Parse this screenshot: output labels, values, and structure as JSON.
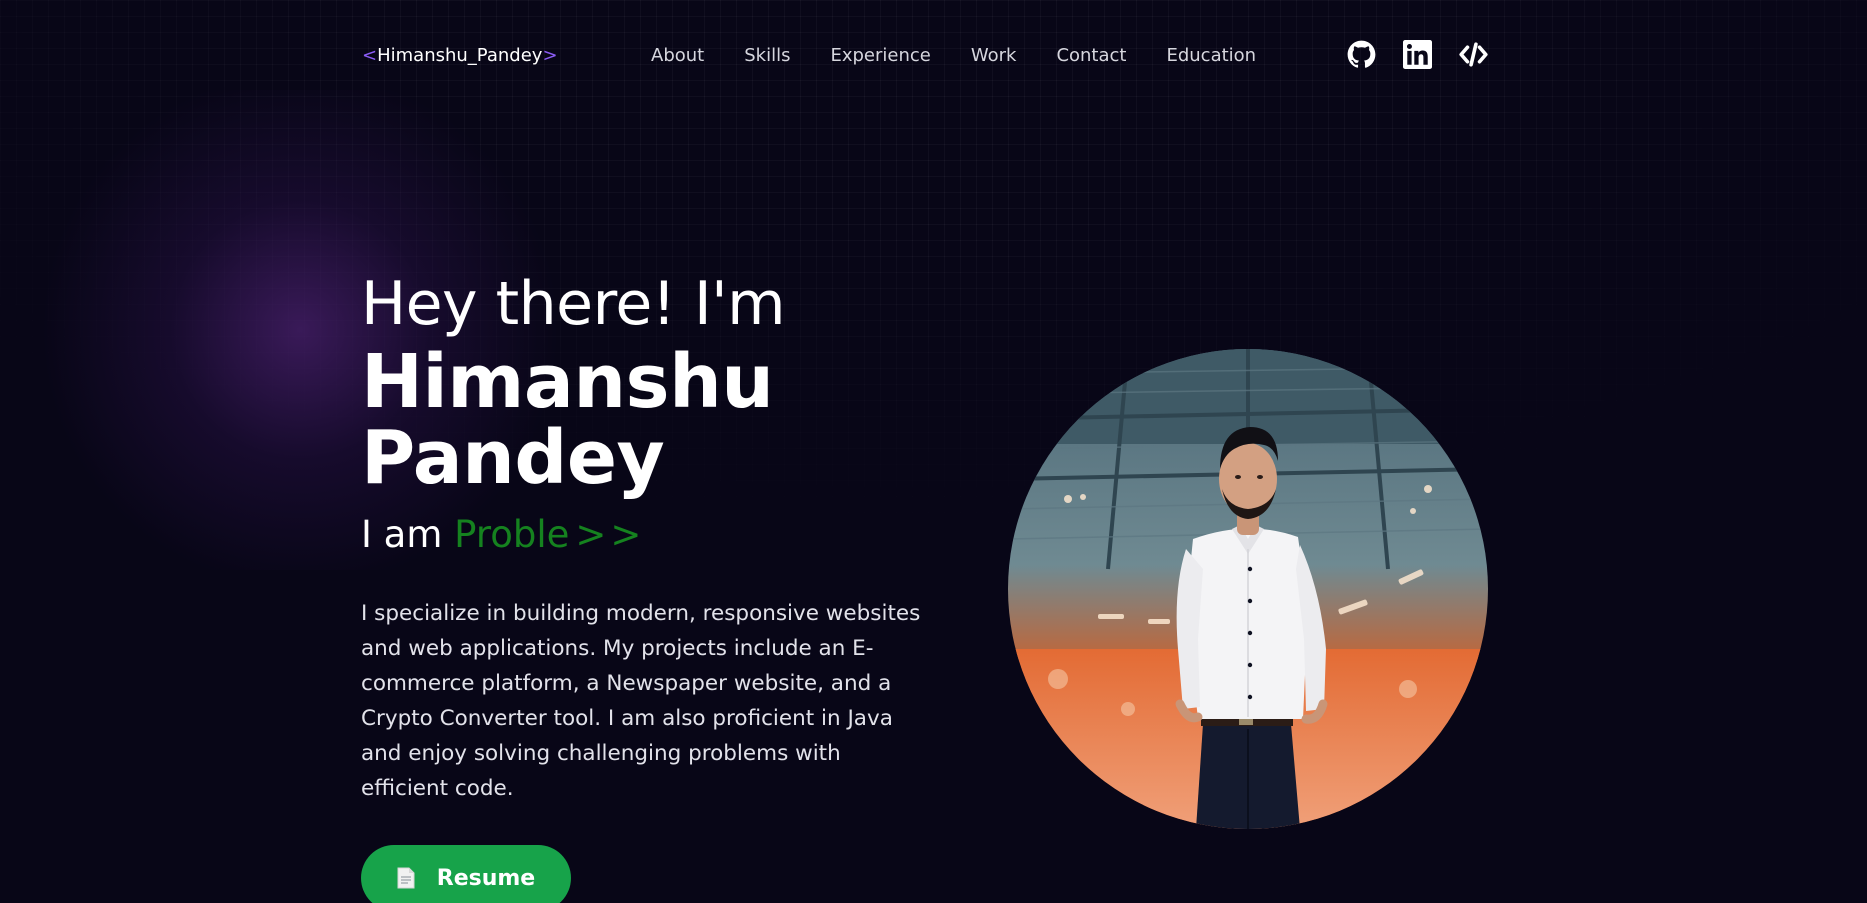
{
  "header": {
    "logo": {
      "open": "<",
      "text": "Himanshu_Pandey",
      "close": ">"
    },
    "nav": [
      {
        "label": "About"
      },
      {
        "label": "Skills"
      },
      {
        "label": "Experience"
      },
      {
        "label": "Work"
      },
      {
        "label": "Contact"
      },
      {
        "label": "Education"
      }
    ],
    "socials": [
      {
        "icon": "github-icon"
      },
      {
        "icon": "linkedin-icon"
      },
      {
        "icon": "code-icon"
      }
    ]
  },
  "hero": {
    "greeting": "Hey there! I'm",
    "name": "Himanshu Pandey",
    "typing_prefix": "I am ",
    "typing_text": "Proble",
    "typing_cursor": ">>",
    "intro": "I specialize in building modern, responsive websites and web applications. My projects include an E-commerce platform, a Newspaper website, and a Crypto Converter tool. I am also proficient in Java and enjoy solving challenging problems with efficient code.",
    "resume_label": "Resume"
  },
  "colors": {
    "background": "#080617",
    "accent_green": "#17a34a",
    "typing_green": "#15821f",
    "bracket_purple": "#8b5cf6",
    "glow_purple": "#622a8e"
  }
}
